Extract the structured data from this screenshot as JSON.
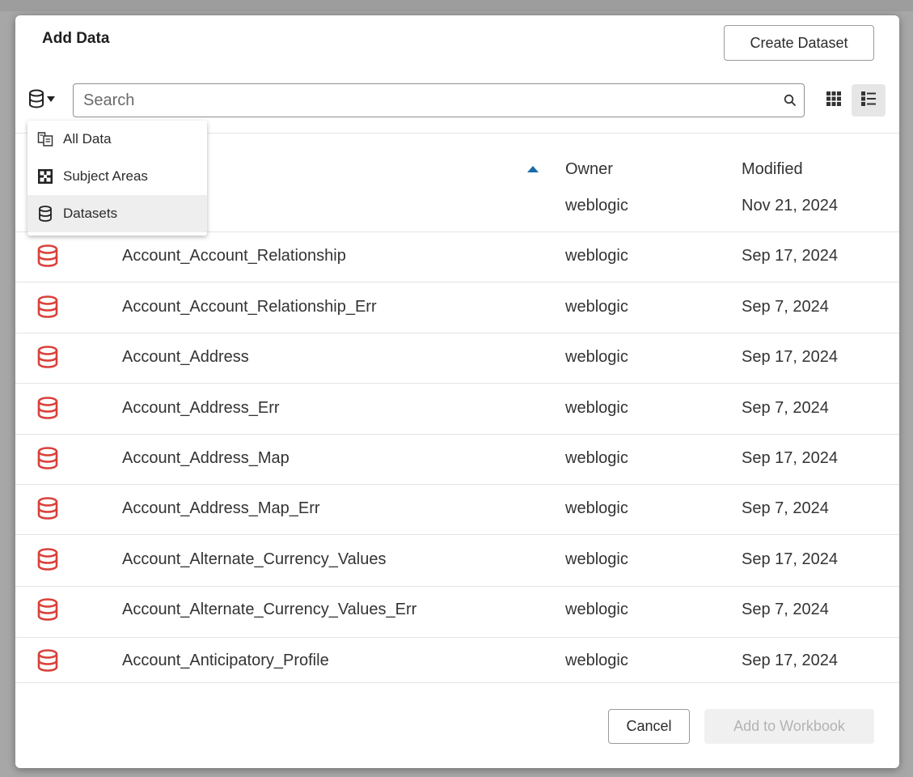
{
  "dialog": {
    "title": "Add Data",
    "create_dataset_label": "Create Dataset",
    "cancel_label": "Cancel",
    "add_to_workbook_label": "Add to Workbook"
  },
  "search": {
    "placeholder": "Search"
  },
  "source_menu": {
    "items": [
      {
        "label": "All Data",
        "icon": "all-data-icon"
      },
      {
        "label": "Subject Areas",
        "icon": "subject-areas-icon"
      },
      {
        "label": "Datasets",
        "icon": "dataset-icon",
        "selected": true
      }
    ]
  },
  "table": {
    "columns": {
      "owner": "Owner",
      "modified": "Modified"
    },
    "sort": {
      "direction": "ascending"
    },
    "rows": [
      {
        "name": "",
        "owner": "weblogic",
        "modified": "Nov 21, 2024"
      },
      {
        "name": "Account_Account_Relationship",
        "owner": "weblogic",
        "modified": "Sep 17, 2024"
      },
      {
        "name": "Account_Account_Relationship_Err",
        "owner": "weblogic",
        "modified": "Sep 7, 2024"
      },
      {
        "name": "Account_Address",
        "owner": "weblogic",
        "modified": "Sep 17, 2024"
      },
      {
        "name": "Account_Address_Err",
        "owner": "weblogic",
        "modified": "Sep 7, 2024"
      },
      {
        "name": "Account_Address_Map",
        "owner": "weblogic",
        "modified": "Sep 17, 2024"
      },
      {
        "name": "Account_Address_Map_Err",
        "owner": "weblogic",
        "modified": "Sep 7, 2024"
      },
      {
        "name": "Account_Alternate_Currency_Values",
        "owner": "weblogic",
        "modified": "Sep 17, 2024"
      },
      {
        "name": "Account_Alternate_Currency_Values_Err",
        "owner": "weblogic",
        "modified": "Sep 7, 2024"
      },
      {
        "name": "Account_Anticipatory_Profile",
        "owner": "weblogic",
        "modified": "Sep 17, 2024"
      }
    ]
  },
  "colors": {
    "dataset_icon": "#d9413a",
    "sort_arrow": "#1a6aa8",
    "disabled_text": "#b3b3b3"
  }
}
